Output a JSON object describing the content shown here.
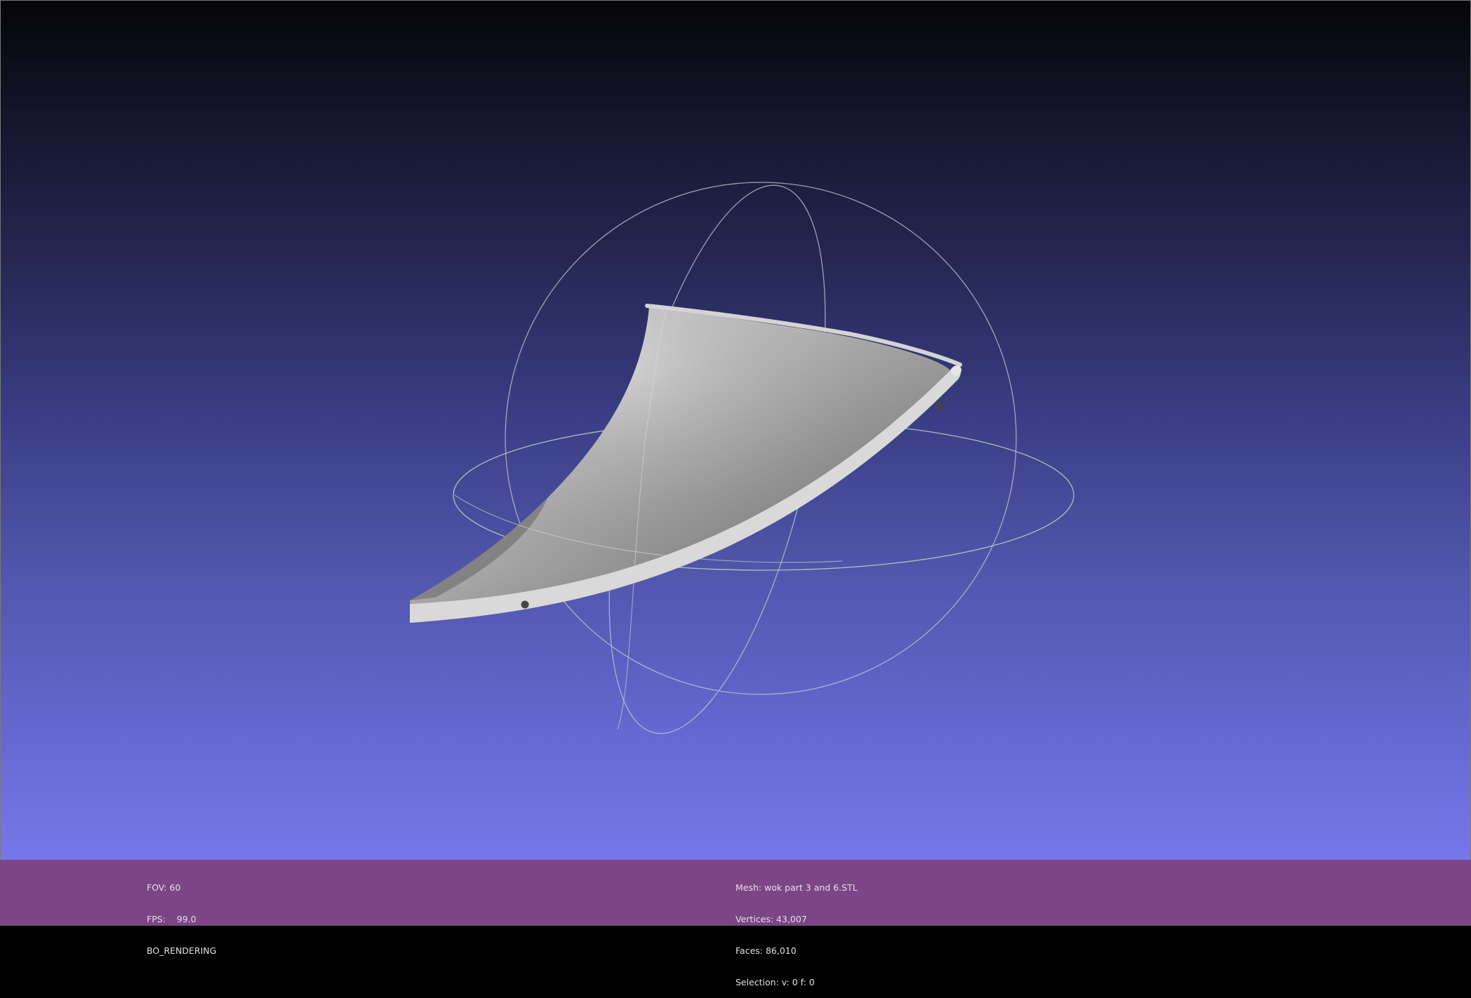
{
  "viewer": {
    "background_top": "#050508",
    "background_bottom": "#7679ea",
    "status_bar_color": "#7c4585",
    "trackball_color": "#c9c9d8",
    "mesh_color": "#bdbdbd"
  },
  "status_left": {
    "fov": "FOV: 60",
    "fps": "FPS:    99.0",
    "render_mode": "BO_RENDERING"
  },
  "status_mesh": {
    "mesh": "Mesh: wok part 3 and 6.STL",
    "vertices": "Vertices: 43,007",
    "faces": "Faces: 86,010",
    "selection": "Selection: v: 0 f: 0"
  }
}
